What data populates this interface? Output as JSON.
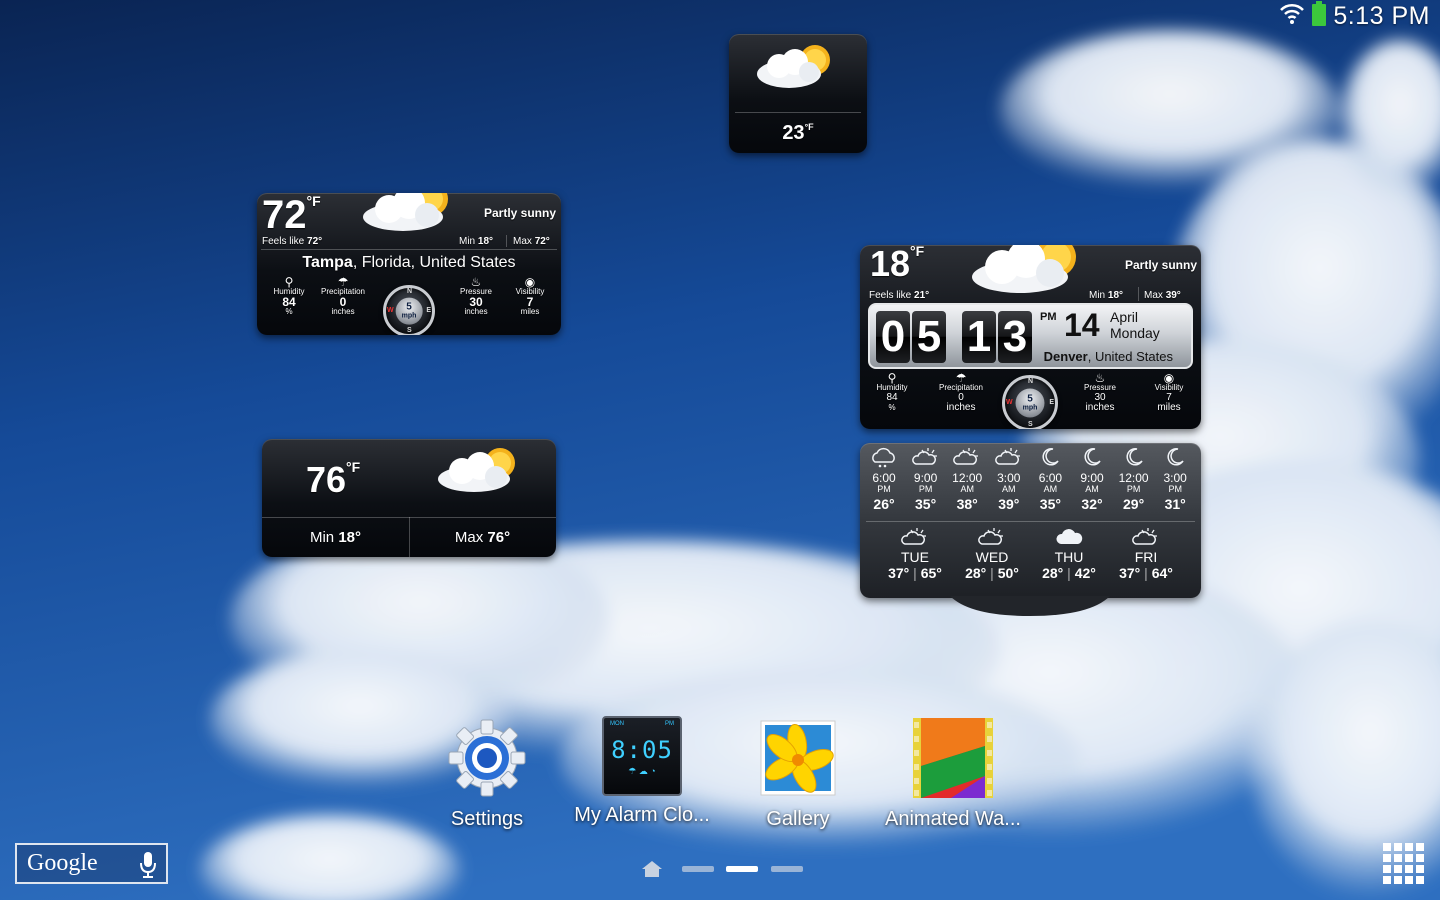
{
  "status_bar": {
    "time": "5:13 PM",
    "wifi_icon": "wifi-icon",
    "battery_icon": "battery-icon",
    "battery_color": "#3cc83c"
  },
  "widget_small": {
    "temp": "23",
    "unit": "°F"
  },
  "widget_tampa": {
    "temp": "72",
    "unit": "°F",
    "condition": "Partly sunny",
    "feels_like_label": "Feels like",
    "feels_like": "72°",
    "min_label": "Min",
    "min": "18°",
    "max_label": "Max",
    "max": "72°",
    "city": "Tampa",
    "region": ", Florida, United States",
    "humidity": {
      "label": "Humidity",
      "value": "84",
      "unit": "%"
    },
    "precipitation": {
      "label": "Precipitation",
      "value": "0",
      "unit": "inches"
    },
    "wind": {
      "speed": "5",
      "unit": "mph",
      "n": "N",
      "s": "S",
      "e": "E",
      "w": "W"
    },
    "pressure": {
      "label": "Pressure",
      "value": "30",
      "unit": "inches"
    },
    "visibility": {
      "label": "Visibility",
      "value": "7",
      "unit": "miles"
    }
  },
  "widget_minmax": {
    "temp": "76",
    "unit": "°F",
    "min_label": "Min",
    "min": "18°",
    "max_label": "Max",
    "max": "76°"
  },
  "widget_denver": {
    "temp": "18",
    "unit": "°F",
    "condition": "Partly sunny",
    "feels_like_label": "Feels like",
    "feels_like": "21°",
    "min_label": "Min",
    "min": "18°",
    "max_label": "Max",
    "max": "39°",
    "clock": {
      "h1": "0",
      "h2": "5",
      "m1": "1",
      "m2": "3",
      "ampm": "PM",
      "day": "14",
      "month": "April",
      "weekday": "Monday"
    },
    "city": "Denver",
    "region": ", United States",
    "humidity": {
      "label": "Humidity",
      "value": "84",
      "unit": "%"
    },
    "precipitation": {
      "label": "Precipitation",
      "value": "0",
      "unit": "inches"
    },
    "wind": {
      "speed": "5",
      "unit": "mph",
      "n": "N",
      "s": "S",
      "e": "E",
      "w": "W"
    },
    "pressure": {
      "label": "Pressure",
      "value": "30",
      "unit": "inches"
    },
    "visibility": {
      "label": "Visibility",
      "value": "7",
      "unit": "miles"
    },
    "hourly": [
      {
        "time": "6:00",
        "ampm": "PM",
        "temp": "26°",
        "icon": "partly-cloudy-night-icon"
      },
      {
        "time": "9:00",
        "ampm": "PM",
        "temp": "35°",
        "icon": "partly-sunny-icon"
      },
      {
        "time": "12:00",
        "ampm": "AM",
        "temp": "38°",
        "icon": "partly-sunny-icon"
      },
      {
        "time": "3:00",
        "ampm": "AM",
        "temp": "39°",
        "icon": "partly-sunny-icon"
      },
      {
        "time": "6:00",
        "ampm": "AM",
        "temp": "35°",
        "icon": "moon-icon"
      },
      {
        "time": "9:00",
        "ampm": "AM",
        "temp": "32°",
        "icon": "moon-icon"
      },
      {
        "time": "12:00",
        "ampm": "PM",
        "temp": "29°",
        "icon": "moon-icon"
      },
      {
        "time": "3:00",
        "ampm": "PM",
        "temp": "31°",
        "icon": "moon-icon"
      }
    ],
    "daily": [
      {
        "day": "TUE",
        "low": "37°",
        "high": "65°",
        "icon": "partly-sunny-icon"
      },
      {
        "day": "WED",
        "low": "28°",
        "high": "50°",
        "icon": "partly-sunny-icon"
      },
      {
        "day": "THU",
        "low": "28°",
        "high": "42°",
        "icon": "cloudy-icon"
      },
      {
        "day": "FRI",
        "low": "37°",
        "high": "64°",
        "icon": "partly-sunny-icon"
      }
    ]
  },
  "apps": [
    {
      "label": "Settings",
      "icon": "settings-gear-icon"
    },
    {
      "label": "My Alarm Clo...",
      "icon": "alarm-clock-app-icon",
      "clock_text": "8:05",
      "top_left": "MON",
      "top_right": "PM"
    },
    {
      "label": "Gallery",
      "icon": "gallery-flower-icon"
    },
    {
      "label": "Animated Wa...",
      "icon": "animated-wallpaper-icon"
    }
  ],
  "search": {
    "label": "Google",
    "mic_icon": "microphone-icon"
  },
  "pages": {
    "count": 3,
    "current": 2,
    "home_icon": "home-icon"
  },
  "all_apps_icon": "app-drawer-grid-icon"
}
